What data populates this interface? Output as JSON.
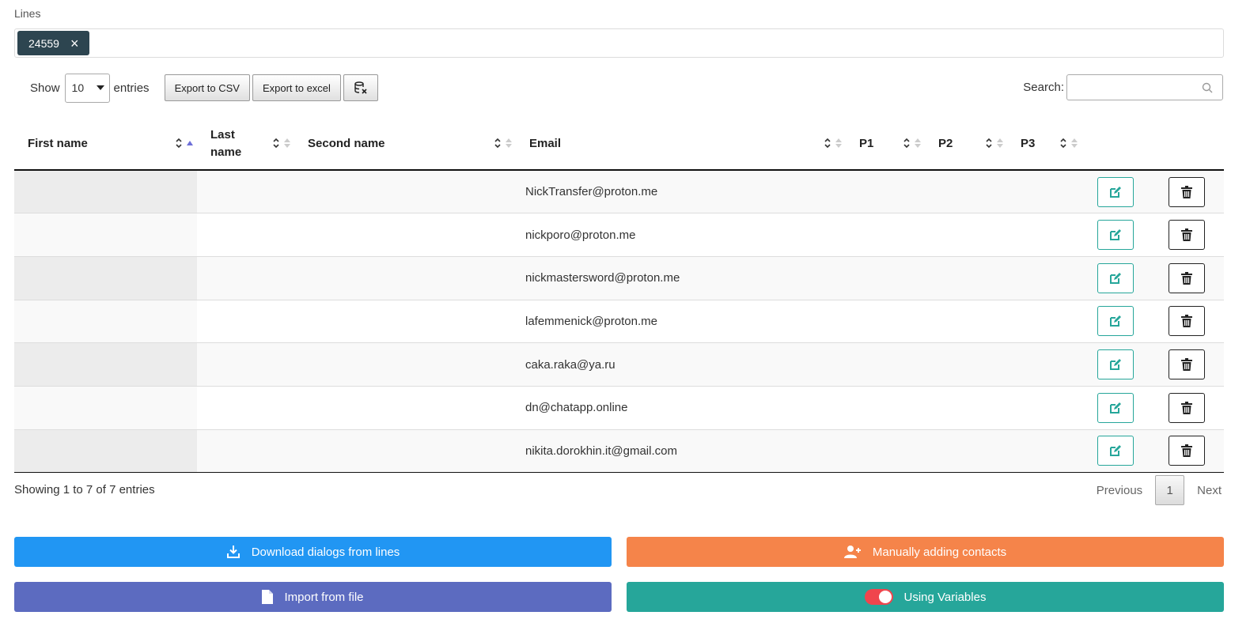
{
  "lines": {
    "label": "Lines",
    "tags": [
      {
        "value": "24559",
        "remove": "×"
      }
    ]
  },
  "toolbar": {
    "show_label": "Show",
    "entries_select": "10",
    "entries_label": "entries",
    "export_csv": "Export to CSV",
    "export_excel": "Export to excel",
    "clear_icon": "database-x-icon"
  },
  "search": {
    "label": "Search:",
    "value": ""
  },
  "table": {
    "columns": [
      "First name",
      "Last name",
      "Second name",
      "Email",
      "P1",
      "P2",
      "P3"
    ],
    "rows": [
      {
        "first": "",
        "last": "",
        "second": "",
        "email": "NickTransfer@proton.me",
        "p1": "",
        "p2": "",
        "p3": ""
      },
      {
        "first": "",
        "last": "",
        "second": "",
        "email": "nickporo@proton.me",
        "p1": "",
        "p2": "",
        "p3": ""
      },
      {
        "first": "",
        "last": "",
        "second": "",
        "email": "nickmastersword@proton.me",
        "p1": "",
        "p2": "",
        "p3": ""
      },
      {
        "first": "",
        "last": "",
        "second": "",
        "email": "lafemmenick@proton.me",
        "p1": "",
        "p2": "",
        "p3": ""
      },
      {
        "first": "",
        "last": "",
        "second": "",
        "email": "caka.raka@ya.ru",
        "p1": "",
        "p2": "",
        "p3": ""
      },
      {
        "first": "",
        "last": "",
        "second": "",
        "email": "dn@chatapp.online",
        "p1": "",
        "p2": "",
        "p3": ""
      },
      {
        "first": "",
        "last": "",
        "second": "",
        "email": "nikita.dorokhin.it@gmail.com",
        "p1": "",
        "p2": "",
        "p3": ""
      }
    ]
  },
  "footer": {
    "info": "Showing 1 to 7 of 7 entries",
    "previous": "Previous",
    "page": "1",
    "next": "Next"
  },
  "actions": {
    "download": "Download dialogs from lines",
    "manual": "Manually adding contacts",
    "import": "Import from file",
    "variables": "Using Variables"
  },
  "colors": {
    "tag": "#2d4550",
    "download": "#2196f3",
    "manual": "#f5844a",
    "import": "#5c6bc0",
    "variables": "#26a69a",
    "toggle_on": "#f0454d"
  }
}
